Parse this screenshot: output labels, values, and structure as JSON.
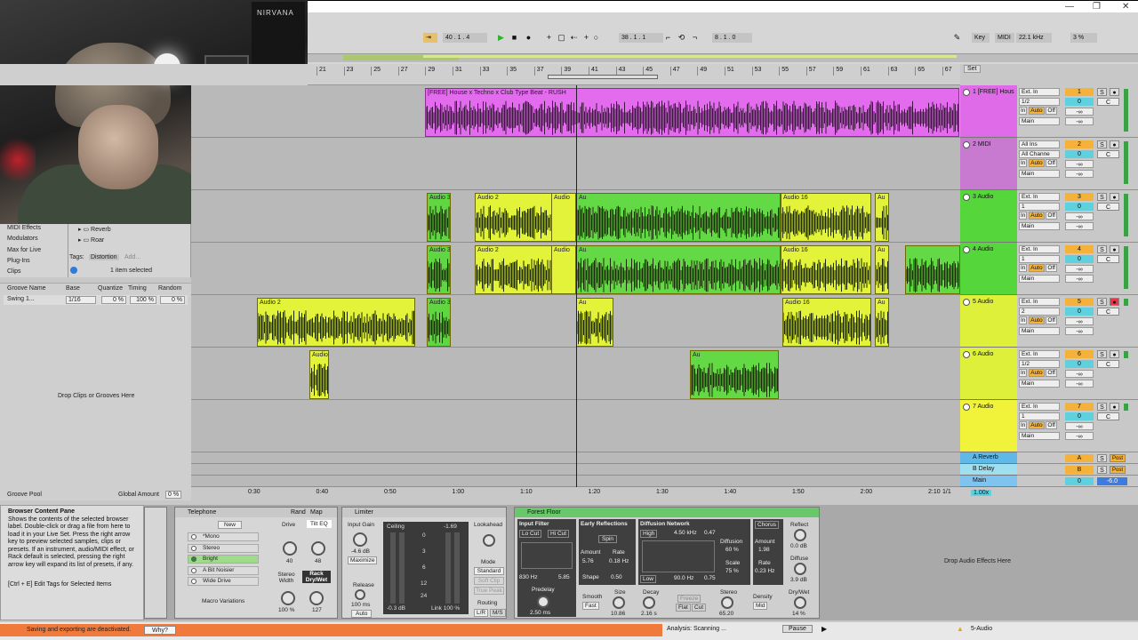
{
  "transport": {
    "tempo_label": "40 . 1 . 4",
    "position": "38 . 1 . 1",
    "loop_length": "8 . 1 . 0",
    "key_label": "Key",
    "midi_label": "MIDI",
    "sample_rate": "22.1 kHz",
    "cpu": "3 %"
  },
  "ruler": {
    "bars": [
      "21",
      "23",
      "25",
      "27",
      "29",
      "31",
      "33",
      "35",
      "37",
      "39",
      "41",
      "43",
      "45",
      "47",
      "49",
      "51",
      "53",
      "55",
      "57",
      "59",
      "61",
      "63",
      "65",
      "67"
    ],
    "set_label": "Set"
  },
  "timeline": {
    "times": [
      "0:30",
      "0:40",
      "0:50",
      "1:00",
      "1:10",
      "1:20",
      "1:30",
      "1:40",
      "1:50",
      "2:00",
      "2:10"
    ],
    "fraction": "1/1"
  },
  "browser": {
    "items": [
      "MIDI Effects",
      "Modulators",
      "Max for Live",
      "Plug-Ins",
      "Clips"
    ],
    "folders": [
      "Reverb",
      "Roar"
    ],
    "tags_label": "Tags:",
    "tag_value": "Distortion",
    "tag_add": "Add...",
    "selected": "1 item selected"
  },
  "groove": {
    "headers": [
      "Groove Name",
      "Base",
      "Quantize",
      "Timing",
      "Random"
    ],
    "row": {
      "name": "Swing 1...",
      "base": "1/16",
      "quantize": "0 %",
      "timing": "100 %",
      "random": "0 %"
    },
    "drop_text": "Drop Clips or Grooves Here",
    "pool_label": "Groove Pool",
    "global_label": "Global Amount",
    "global_value": "0 %"
  },
  "info": {
    "title": "Browser Content Pane",
    "body": "Shows the contents of the selected browser label. Double-click or drag a file from here to load it in your Live Set. Press the right arrow key to preview selected samples, clips or presets. If an instrument, audio/MIDI effect, or Rack default is selected, pressing the right arrow key will expand its list of presets, if any.",
    "shortcut": "[Ctrl + E] Edit Tags for Selected Items"
  },
  "tracks": [
    {
      "name": "1 [FREE] Hous",
      "color": "#e06be8",
      "input": "Ext. In",
      "ch": "1/2",
      "out": "Main",
      "num": "1"
    },
    {
      "name": "2 MIDI",
      "color": "#c77ad0",
      "input": "All Ins",
      "ch": "All Channe",
      "out": "Main",
      "num": "2"
    },
    {
      "name": "3 Audio",
      "color": "#55d63a",
      "input": "Ext. In",
      "ch": "1",
      "out": "Main",
      "num": "3"
    },
    {
      "name": "4 Audio",
      "color": "#55d63a",
      "input": "Ext. In",
      "ch": "1",
      "out": "Main",
      "num": "4"
    },
    {
      "name": "5 Audio",
      "color": "#dff03a",
      "input": "Ext. In",
      "ch": "2",
      "out": "Main",
      "num": "5"
    },
    {
      "name": "6 Audio",
      "color": "#dff03a",
      "input": "Ext. In",
      "ch": "1/2",
      "out": "Main",
      "num": "6"
    },
    {
      "name": "7 Audio",
      "color": "#f1f23a",
      "input": "Ext. In",
      "ch": "1",
      "out": "Main",
      "num": "7"
    }
  ],
  "returns": [
    {
      "name": "A Reverb",
      "letter": "A"
    },
    {
      "name": "B Delay",
      "letter": "B"
    },
    {
      "name": "Main",
      "letter": ""
    }
  ],
  "clips": {
    "main": "[FREE] House x Techno x Club Type Beat - RUSH",
    "audio3": "Audio 3",
    "audio2": "Audio 2",
    "audio16": "Audio 16",
    "audio": "Audio",
    "au": "Au"
  },
  "devices": {
    "telephone": {
      "title": "Telephone",
      "rand": "Rand",
      "map": "Map",
      "new": "New",
      "presets": [
        "*Mono",
        "Stereo",
        "Bright",
        "A Bit Noisier",
        "Wide Drive"
      ],
      "drive": "Drive",
      "drive_val": "40",
      "tilt": "Tilt EQ",
      "tilt_val": "48",
      "stereo_width": "Stereo Width",
      "stereo_val": "100 %",
      "rack": "Rack Dry/Wet",
      "rack_val": "127",
      "macro": "Macro Variations"
    },
    "limiter": {
      "title": "Limiter",
      "input_gain": "Input Gain",
      "input_val": "-4.6 dB",
      "maximize": "Maximize",
      "ceiling": "Ceiling",
      "ceiling_val": "-0.3 dB",
      "peak": "-1.69",
      "release": "Release",
      "release_val": "100 ms",
      "auto": "Auto",
      "lookahead": "Lookahead",
      "mode": "Mode",
      "modes": [
        "Standard",
        "Soft Clip",
        "True Peak"
      ],
      "routing": "Routing",
      "routing_lr": "L/R",
      "routing_ms": "M/S",
      "link": "Link",
      "link_val": "100 %",
      "scale": [
        "0",
        "3",
        "6",
        "12",
        "24"
      ]
    },
    "forest": {
      "title": "Forest Floor",
      "input_filter": "Input Filter",
      "lo_cut": "Lo Cut",
      "hi_cut": "Hi Cut",
      "freq_lo": "830 Hz",
      "freq_val": "5.85",
      "early": "Early Reflections",
      "spin": "Spin",
      "amount": "Amount",
      "amount_val": "5.76",
      "rate": "Rate",
      "rate_val": "0.18 Hz",
      "shape": "Shape",
      "shape_val": "0.50",
      "diffusion": "Diffusion Network",
      "high": "High",
      "diff_freq": "4.50 kHz",
      "diff_gain": "0.47",
      "diffusion_lbl": "Diffusion",
      "diffusion_val": "60 %",
      "scale": "Scale",
      "scale_val": "75 %",
      "low": "Low",
      "low_freq": "90.0 Hz",
      "low_gain": "0.75",
      "chorus": "Chorus",
      "ch_amount": "Amount",
      "ch_amount_val": "1.98",
      "ch_rate": "Rate",
      "ch_rate_val": "0.23 Hz",
      "predelay": "Predelay",
      "predelay_val": "2.50 ms",
      "smooth": "Smooth",
      "smooth_val": "Fast",
      "size": "Size",
      "size_val": "10.86",
      "decay": "Decay",
      "decay_val": "2.16 s",
      "freeze": "Freeze",
      "flat": "Flat",
      "cut": "Cut",
      "stereo": "Stereo",
      "stereo_val": "65.20",
      "density": "Density",
      "density_val": "Mid",
      "reflect": "Reflect",
      "reflect_val": "0.0 dB",
      "diffuse": "Diffuse",
      "diffuse_val": "3.9 dB",
      "drywet": "Dry/Wet",
      "drywet_val": "14 %"
    },
    "drop": "Drop Audio Effects Here"
  },
  "status": {
    "message": "Saving and exporting are deactivated.",
    "why": "Why?",
    "analysis": "Analysis: Scanning ...",
    "pause": "Pause",
    "track": "5-Audio"
  },
  "mixer_values": {
    "vol": "0",
    "pan": "C",
    "send": "-∞",
    "in": "In",
    "auto": "Auto",
    "off": "Off",
    "post": "Post",
    "master_vol": "0",
    "master_db": "-6.0",
    "zoom": "1.00x"
  }
}
